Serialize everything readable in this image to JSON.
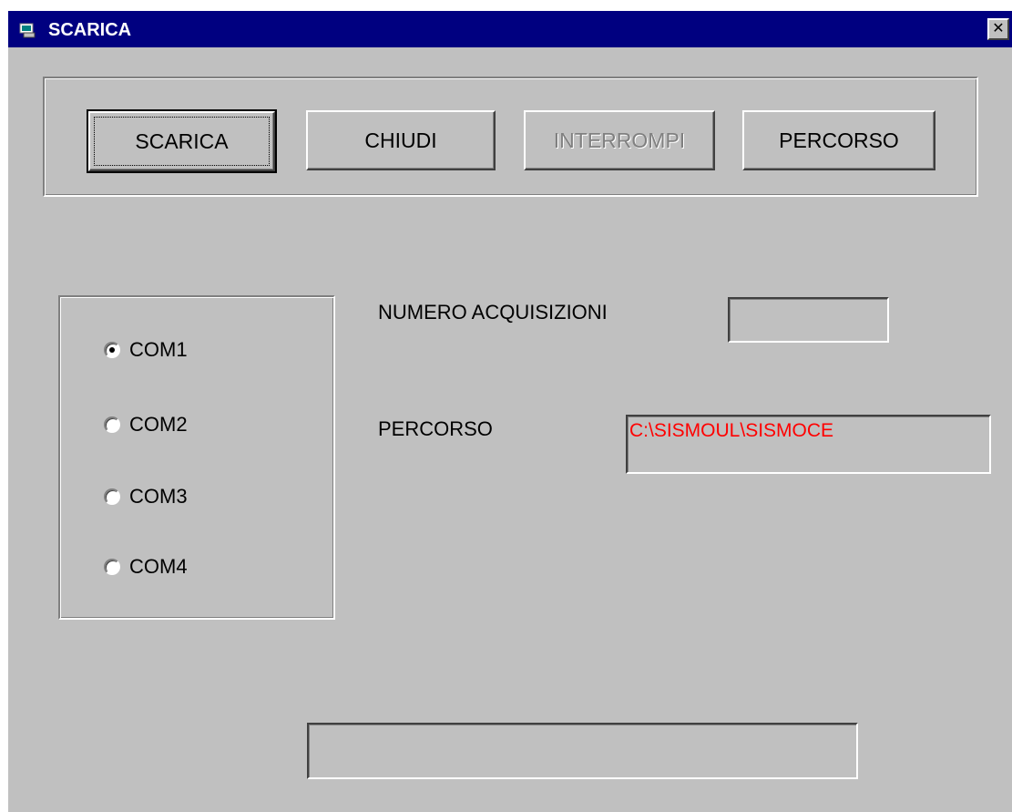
{
  "window": {
    "title": "SCARICA",
    "close_glyph": "✕"
  },
  "toolbar": {
    "buttons": [
      {
        "label": "SCARICA",
        "state": "default"
      },
      {
        "label": "CHIUDI",
        "state": "normal"
      },
      {
        "label": "INTERROMPI",
        "state": "disabled"
      },
      {
        "label": "PERCORSO",
        "state": "normal"
      }
    ]
  },
  "ports": {
    "options": [
      {
        "label": "COM1",
        "selected": true
      },
      {
        "label": "COM2",
        "selected": false
      },
      {
        "label": "COM3",
        "selected": false
      },
      {
        "label": "COM4",
        "selected": false
      }
    ]
  },
  "form": {
    "acquisitions_label": "NUMERO ACQUISIZIONI",
    "acquisitions_value": "",
    "path_label": "PERCORSO",
    "path_value": "C:\\SISMOUL\\SISMOCE",
    "status_value": ""
  },
  "colors": {
    "titlebar": "#000080",
    "face": "#c0c0c0",
    "path_text": "#ff0000",
    "disabled_text": "#808080"
  }
}
